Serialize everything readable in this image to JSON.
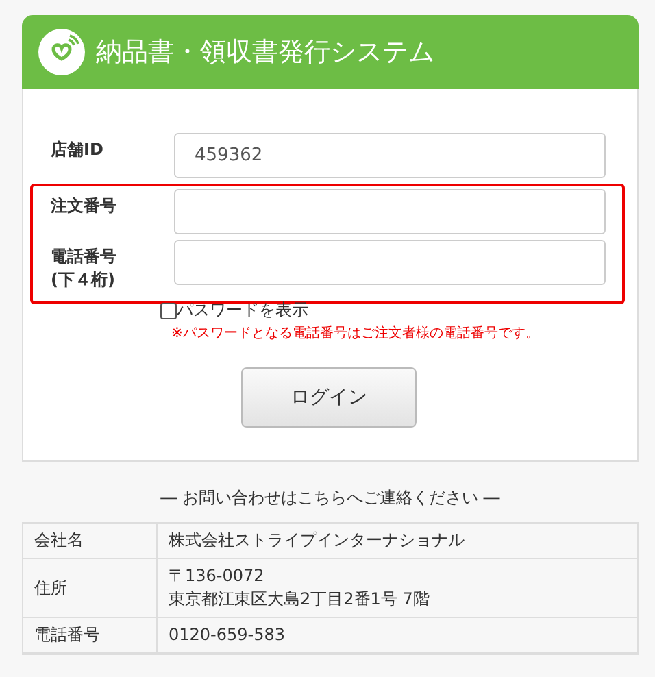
{
  "header": {
    "title": "納品書・領収書発行システム"
  },
  "fields": [
    {
      "label": "店舗ID",
      "value": "459362"
    },
    {
      "label": "注文番号",
      "highlighted": true
    },
    {
      "label": "電話番号\n(下４桁)",
      "highlighted": true
    }
  ],
  "show_password": {
    "label": "パスワードを表示",
    "checked": false
  },
  "note": "※パスワードとなる電話番号はご注文者様の電話番号です。",
  "login_button": "ログイン",
  "contact_heading": "― お問い合わせはこちらへご連絡ください ―",
  "contact_rows": [
    {
      "label": "会社名",
      "value": "株式会社ストライプインターナショナル"
    },
    {
      "label": "住所",
      "value": "〒136-0072\n東京都江東区大島2丁目2番1号 7階"
    },
    {
      "label": "電話番号",
      "value": "0120-659-583"
    }
  ]
}
